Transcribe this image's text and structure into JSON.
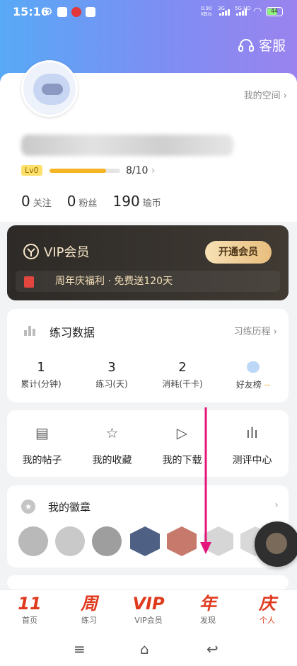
{
  "status": {
    "time": "15:16",
    "net_speed": "0.90",
    "net_unit": "KB/s",
    "signal1": "3G",
    "signal2": "5G HD",
    "battery": "44"
  },
  "header": {
    "service_label": "客服"
  },
  "profile": {
    "my_space": "我的空间",
    "level": "Lv0",
    "level_progress": "8/10",
    "level_fraction": 0.8,
    "stats": [
      {
        "num": "0",
        "label": "关注"
      },
      {
        "num": "0",
        "label": "粉丝"
      },
      {
        "num": "190",
        "label": "瑜币"
      }
    ]
  },
  "vip": {
    "title": "VIP会员",
    "button": "开通会员",
    "promo": "周年庆福利 · 免费送120天"
  },
  "practice": {
    "title": "练习数据",
    "history": "习练历程",
    "metrics": [
      {
        "num": "1",
        "label": "累计(分钟)"
      },
      {
        "num": "3",
        "label": "练习(天)"
      },
      {
        "num": "2",
        "label": "消耗(千卡)"
      }
    ],
    "friends": "好友榜",
    "friends_value": "--"
  },
  "menu": [
    {
      "icon": "document-icon",
      "label": "我的帖子"
    },
    {
      "icon": "star-icon",
      "label": "我的收藏"
    },
    {
      "icon": "play-icon",
      "label": "我的下载"
    },
    {
      "icon": "audio-bars-icon",
      "label": "测评中心"
    }
  ],
  "badges": {
    "title": "我的徽章"
  },
  "tabs": [
    {
      "icon_text": "11",
      "label": "首页"
    },
    {
      "icon_text": "周",
      "label": "练习"
    },
    {
      "icon_text": "VIP",
      "label": "VIP会员"
    },
    {
      "icon_text": "年",
      "label": "发现"
    },
    {
      "icon_text": "庆",
      "label": "个人"
    }
  ],
  "colors": {
    "accent": "#e03a1e",
    "level_bar": "#f6b324",
    "arrow": "#e4147a"
  }
}
